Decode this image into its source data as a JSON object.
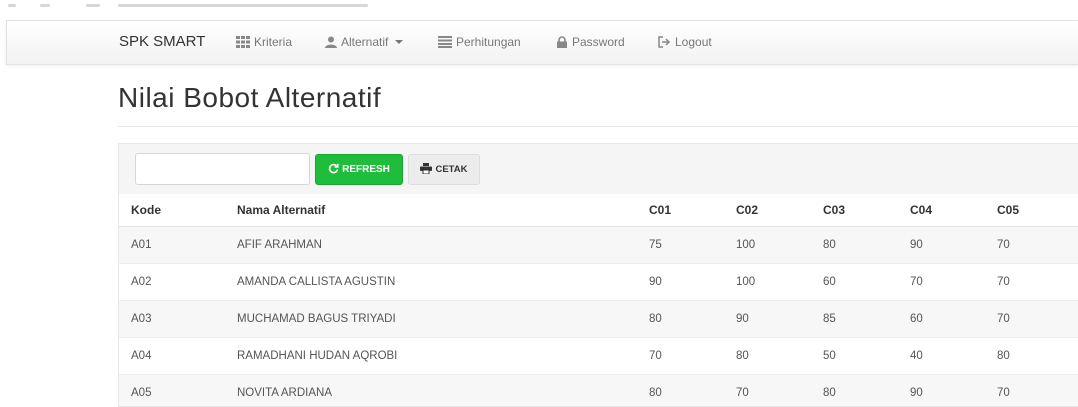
{
  "navbar": {
    "brand": "SPK SMART",
    "items": [
      {
        "label": "Kriteria",
        "icon": "grid-icon"
      },
      {
        "label": "Alternatif",
        "icon": "user-icon"
      },
      {
        "label": "Perhitungan",
        "icon": "list-icon"
      },
      {
        "label": "Password",
        "icon": "lock-icon"
      },
      {
        "label": "Logout",
        "icon": "logout-icon"
      }
    ]
  },
  "page": {
    "title": "Nilai Bobot Alternatif"
  },
  "toolbar": {
    "search_value": "",
    "refresh_label": "REFRESH",
    "print_label": "CETAK",
    "refresh_color": "#1fbd3b"
  },
  "table": {
    "headers": [
      "Kode",
      "Nama Alternatif",
      "C01",
      "C02",
      "C03",
      "C04",
      "C05"
    ],
    "rows": [
      [
        "A01",
        "AFIF ARAHMAN",
        "75",
        "100",
        "80",
        "90",
        "70"
      ],
      [
        "A02",
        "AMANDA CALLISTA AGUSTIN",
        "90",
        "100",
        "60",
        "70",
        "70"
      ],
      [
        "A03",
        "MUCHAMAD BAGUS TRIYADI",
        "80",
        "90",
        "85",
        "60",
        "70"
      ],
      [
        "A04",
        "RAMADHANI HUDAN AQROBI",
        "70",
        "80",
        "50",
        "40",
        "80"
      ],
      [
        "A05",
        "NOVITA ARDIANA",
        "80",
        "70",
        "80",
        "90",
        "70"
      ]
    ]
  }
}
